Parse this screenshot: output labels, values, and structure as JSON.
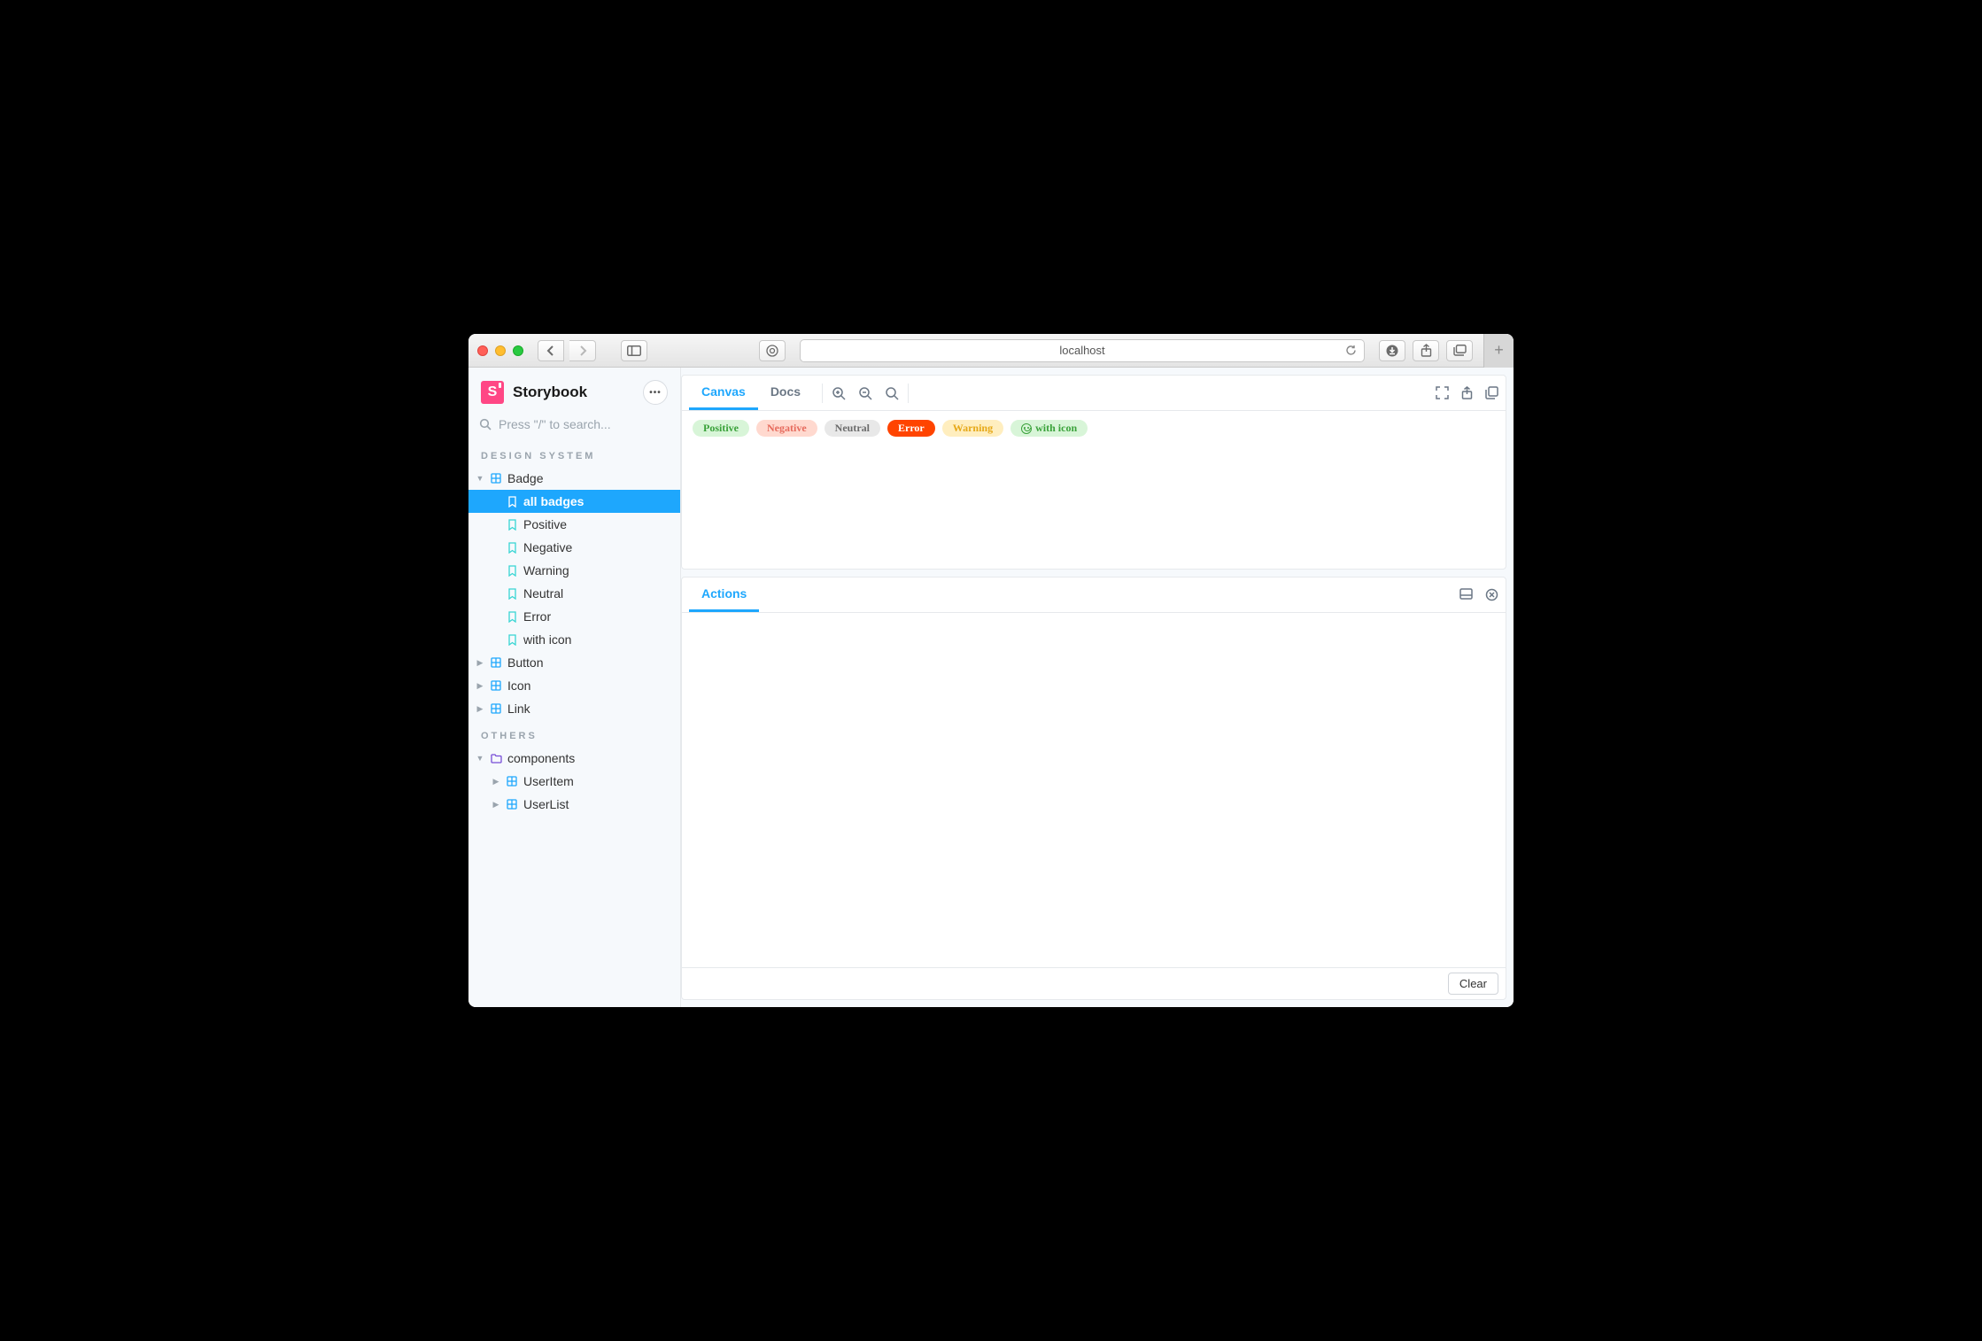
{
  "browser": {
    "url": "localhost"
  },
  "brand": {
    "name": "Storybook",
    "mark": "S"
  },
  "search": {
    "placeholder": "Press \"/\" to search..."
  },
  "sidebar": {
    "sections": [
      {
        "label": "Design System",
        "items": [
          {
            "type": "component",
            "label": "Badge",
            "expanded": true,
            "selected": false,
            "stories": [
              {
                "label": "all badges",
                "selected": true
              },
              {
                "label": "Positive",
                "selected": false
              },
              {
                "label": "Negative",
                "selected": false
              },
              {
                "label": "Warning",
                "selected": false
              },
              {
                "label": "Neutral",
                "selected": false
              },
              {
                "label": "Error",
                "selected": false
              },
              {
                "label": "with icon",
                "selected": false
              }
            ]
          },
          {
            "type": "component",
            "label": "Button",
            "expanded": false
          },
          {
            "type": "component",
            "label": "Icon",
            "expanded": false
          },
          {
            "type": "component",
            "label": "Link",
            "expanded": false
          }
        ]
      },
      {
        "label": "Others",
        "items": [
          {
            "type": "folder",
            "label": "components",
            "expanded": true,
            "children": [
              {
                "type": "component",
                "label": "UserItem",
                "expanded": false
              },
              {
                "type": "component",
                "label": "UserList",
                "expanded": false
              }
            ]
          }
        ]
      }
    ]
  },
  "toolbar": {
    "tabs": {
      "canvas": "Canvas",
      "docs": "Docs"
    }
  },
  "badges": [
    {
      "kind": "positive",
      "label": "Positive"
    },
    {
      "kind": "negative",
      "label": "Negative"
    },
    {
      "kind": "neutral",
      "label": "Neutral"
    },
    {
      "kind": "error",
      "label": "Error"
    },
    {
      "kind": "warning",
      "label": "Warning"
    },
    {
      "kind": "withicon",
      "label": "with icon",
      "icon": true
    }
  ],
  "addons": {
    "tab": "Actions",
    "clear": "Clear"
  }
}
